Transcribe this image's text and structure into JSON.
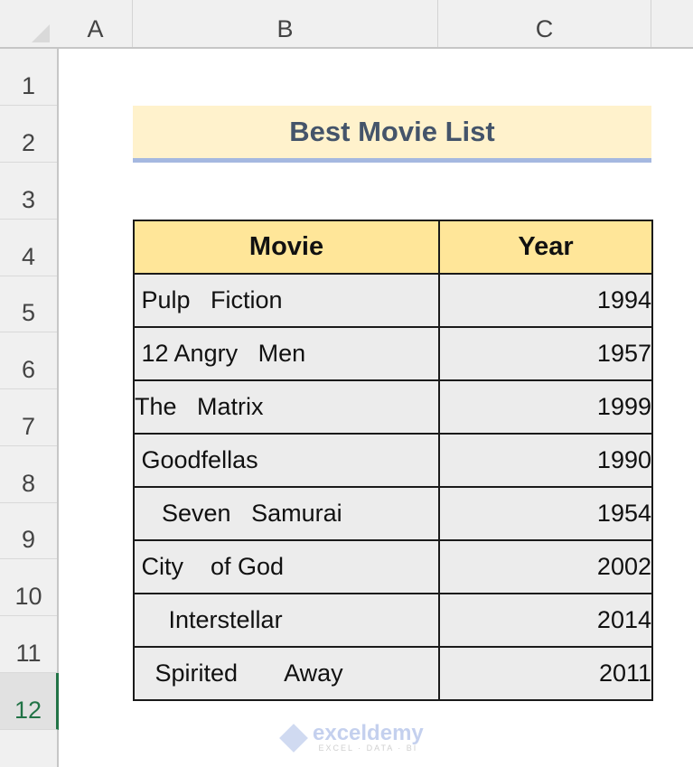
{
  "column_headers": [
    "A",
    "B",
    "C"
  ],
  "row_headers": [
    "1",
    "2",
    "3",
    "4",
    "5",
    "6",
    "7",
    "8",
    "9",
    "10",
    "11",
    "12"
  ],
  "selected_row": "12",
  "title": "Best Movie List",
  "table": {
    "headers": {
      "movie": "Movie",
      "year": "Year"
    },
    "rows": [
      {
        "movie": " Pulp   Fiction",
        "year": "1994"
      },
      {
        "movie": " 12 Angry   Men",
        "year": "1957"
      },
      {
        "movie": "The   Matrix",
        "year": "1999"
      },
      {
        "movie": " Goodfellas",
        "year": "1990"
      },
      {
        "movie": "    Seven   Samurai",
        "year": "1954"
      },
      {
        "movie": " City    of God",
        "year": "2002"
      },
      {
        "movie": "     Interstellar",
        "year": "2014"
      },
      {
        "movie": "   Spirited       Away",
        "year": "2011"
      }
    ]
  },
  "watermark": {
    "name": "exceldemy",
    "tagline": "EXCEL · DATA · BI"
  },
  "colors": {
    "title_fill": "#fff2cc",
    "title_underline": "#a5b8e0",
    "header_fill": "#ffe699",
    "cell_fill": "#ececec",
    "selection": "#217346"
  }
}
